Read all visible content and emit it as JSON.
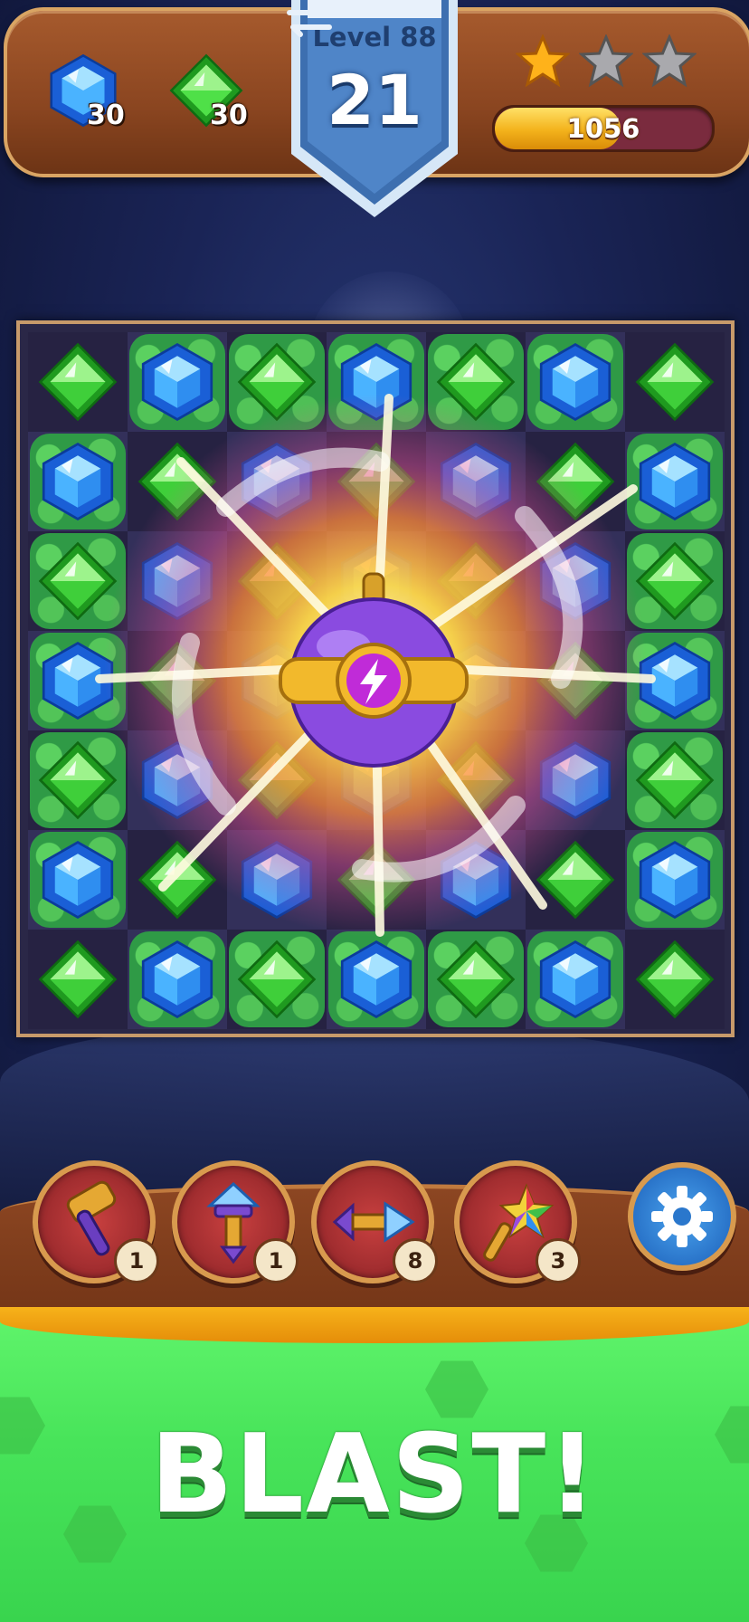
{
  "header": {
    "goals": [
      {
        "gem": "blue-hexagon-gem",
        "count": "30"
      },
      {
        "gem": "green-diamond-gem",
        "count": "30"
      }
    ],
    "level_label": "Level 88",
    "moves_left": "21",
    "stars": {
      "earned": 1,
      "total": 3
    },
    "score": "1056",
    "score_progress_fraction": 0.58
  },
  "board": {
    "rows": 7,
    "cols": 7,
    "gems": [
      [
        "green",
        "blue",
        "green",
        "blue",
        "green",
        "blue",
        "green"
      ],
      [
        "blue",
        "green",
        "blue",
        "green",
        "blue",
        "green",
        "blue"
      ],
      [
        "green",
        "blue",
        "green",
        "blue",
        "green",
        "blue",
        "green"
      ],
      [
        "blue",
        "green",
        "blue",
        "green",
        "blue",
        "green",
        "blue"
      ],
      [
        "green",
        "blue",
        "green",
        "blue",
        "green",
        "blue",
        "green"
      ],
      [
        "blue",
        "green",
        "blue",
        "green",
        "blue",
        "green",
        "blue"
      ],
      [
        "green",
        "blue",
        "green",
        "blue",
        "green",
        "blue",
        "green"
      ]
    ],
    "bush_tiles": [
      [
        0,
        1,
        1,
        1,
        1,
        1,
        0
      ],
      [
        1,
        0,
        0,
        0,
        0,
        0,
        1
      ],
      [
        1,
        0,
        0,
        0,
        0,
        0,
        1
      ],
      [
        1,
        0,
        0,
        0,
        0,
        0,
        1
      ],
      [
        1,
        0,
        0,
        0,
        0,
        0,
        1
      ],
      [
        1,
        0,
        0,
        0,
        0,
        0,
        1
      ],
      [
        0,
        1,
        1,
        1,
        1,
        1,
        0
      ]
    ],
    "center_item": "lightning-bomb-icon"
  },
  "boosters": [
    {
      "icon": "hammer-icon",
      "count": "1"
    },
    {
      "icon": "crystal-drill-icon",
      "count": "1"
    },
    {
      "icon": "arrow-rocket-icon",
      "count": "8"
    },
    {
      "icon": "rainbow-wand-icon",
      "count": "3"
    }
  ],
  "settings_icon": "gear-icon",
  "banner_text": "BLAST!",
  "colors": {
    "blue_gem": "#2f8ef0",
    "green_gem": "#3fcf3a",
    "wood": "#8a4520",
    "banner_green": "#48e45a",
    "shield_blue": "#3d6fb0"
  }
}
